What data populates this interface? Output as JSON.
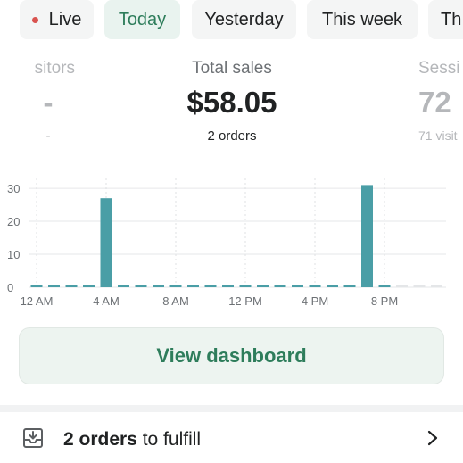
{
  "tabs": {
    "live": "Live",
    "today": "Today",
    "yesterday": "Yesterday",
    "this_week": "This week",
    "next_partial": "Th"
  },
  "metrics": {
    "visitors": {
      "label": "sitors",
      "value": "-",
      "sub": "-"
    },
    "sales": {
      "label": "Total sales",
      "value": "$58.05",
      "sub": "2 orders"
    },
    "sessions": {
      "label": "Sessi",
      "value": "72",
      "sub": "71 visit"
    }
  },
  "chart_data": {
    "type": "bar",
    "y_ticks": [
      "0",
      "10",
      "20",
      "30"
    ],
    "x_ticks": [
      "12 AM",
      "4 AM",
      "8 AM",
      "12 PM",
      "4 PM",
      "8 PM"
    ],
    "ylim": [
      0,
      33
    ],
    "hours": [
      0,
      1,
      2,
      3,
      4,
      5,
      6,
      7,
      8,
      9,
      10,
      11,
      12,
      13,
      14,
      15,
      16,
      17,
      18,
      19,
      20,
      21,
      22,
      23
    ],
    "values": [
      0,
      0,
      0,
      0,
      27,
      0,
      0,
      0,
      0,
      0,
      0,
      0,
      0,
      0,
      0,
      0,
      0,
      0,
      0,
      31,
      0,
      0,
      0,
      0
    ],
    "grid": true,
    "bar_color": "#4a9ea6",
    "future_color": "#e4e6e8"
  },
  "dashboard_button": {
    "label": "View dashboard"
  },
  "fulfill": {
    "count_text": "2 orders",
    "suffix": " to fulfill"
  },
  "colors": {
    "accent": "#2e7d5b",
    "live_dot": "#d9534f",
    "bar": "#4a9ea6"
  }
}
